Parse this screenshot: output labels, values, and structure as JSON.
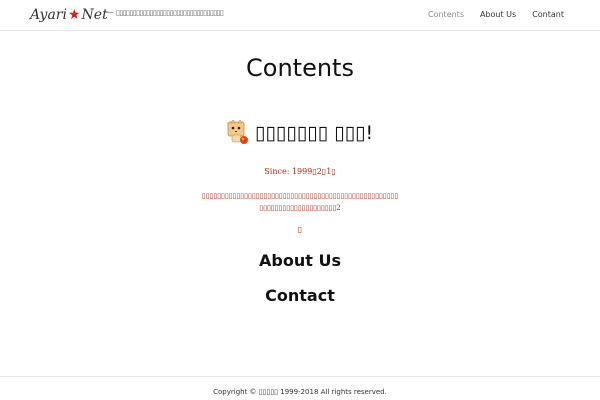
{
  "header": {
    "logo_left": "Ayari",
    "logo_right": "Net",
    "dash": "—",
    "tagline": "▯▯▯▯▯▯▯▯▯▯▯▯▯▯▯▯▯▯▯▯▯▯▯▯▯▯▯▯▯▯▯▯",
    "nav": [
      {
        "label": "Contents",
        "active": true
      },
      {
        "label": "About Us",
        "active": false
      },
      {
        "label": "Contant",
        "active": false
      }
    ]
  },
  "main": {
    "title": "Contents",
    "site_heading": "▯▯▯▯▯▯▯ ▯▯▯!",
    "since": "Since: 1999▯2▯1▯",
    "description": "▯▯▯▯▯▯▯▯▯▯▯▯▯▯▯▯▯▯▯▯▯▯▯▯▯▯▯▯▯▯▯▯▯▯▯▯▯▯▯▯▯▯▯▯▯▯▯▯▯▯▯▯▯▯▯▯▯▯▯▯▯▯▯▯▯▯▯▯▯▯▯2",
    "marker": "▯",
    "about_heading": "About Us",
    "contact_heading": "Contact"
  },
  "footer": {
    "copyright": "Copyright © ▯▯▯▯▯ 1999-2018 All rights reserved."
  },
  "colors": {
    "accent_red": "#b5281a",
    "logo_star": "#d62020"
  },
  "icons": {
    "site_icon": "cat-icon"
  }
}
